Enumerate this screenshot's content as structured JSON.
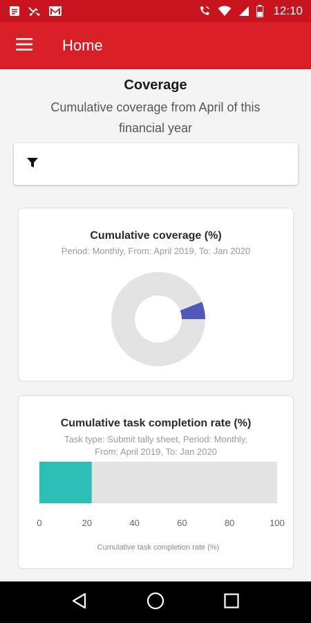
{
  "status_bar": {
    "time": "12:10",
    "left_icons": [
      "notification-icon",
      "missed-call-icon",
      "gmail-icon"
    ],
    "right_icons": [
      "wifi-call-icon",
      "wifi-icon",
      "signal-icon",
      "battery-icon"
    ]
  },
  "app_bar": {
    "title": "Home",
    "menu_icon": "menu-icon"
  },
  "page": {
    "title": "Coverage",
    "subtitle": "Cumulative coverage from April of this financial year"
  },
  "filter": {
    "icon": "filter-icon"
  },
  "coverage_card": {
    "title": "Cumulative coverage (%)",
    "subtitle": "Period: Monthly, From: April 2019, To: Jan 2020"
  },
  "completion_card": {
    "title": "Cumulative task completion rate (%)",
    "subtitle_line1": "Task type: Submit tally sheet, Period: Monthly,",
    "subtitle_line2": "From: April 2019, To: Jan 2020"
  },
  "nav_bar": {
    "icons": [
      "back-icon",
      "home-icon",
      "recents-icon"
    ]
  },
  "colors": {
    "primary": "#d81f26",
    "status": "#c8141f",
    "donut_fill": "#5059b8",
    "bar_fill": "#2bbfb7",
    "track": "#e3e3e3"
  },
  "chart_data": [
    {
      "type": "pie",
      "title": "Cumulative coverage (%)",
      "subtitle": "Period: Monthly, From: April 2019, To: Jan 2020",
      "slices": [
        {
          "label": "",
          "value": 6
        },
        {
          "label": "",
          "value": 94
        }
      ]
    },
    {
      "type": "bar",
      "title": "Cumulative task completion rate (%)",
      "subtitle": "Task type: Submit tally sheet, Period: Monthly, From: April 2019, To: Jan 2020",
      "orientation": "horizontal",
      "values": [
        22
      ],
      "xlabel": "Cumulative task completion rate (%)",
      "xlim": [
        0,
        100
      ],
      "ticks": [
        "0",
        "20",
        "40",
        "60",
        "80",
        "100"
      ]
    }
  ]
}
